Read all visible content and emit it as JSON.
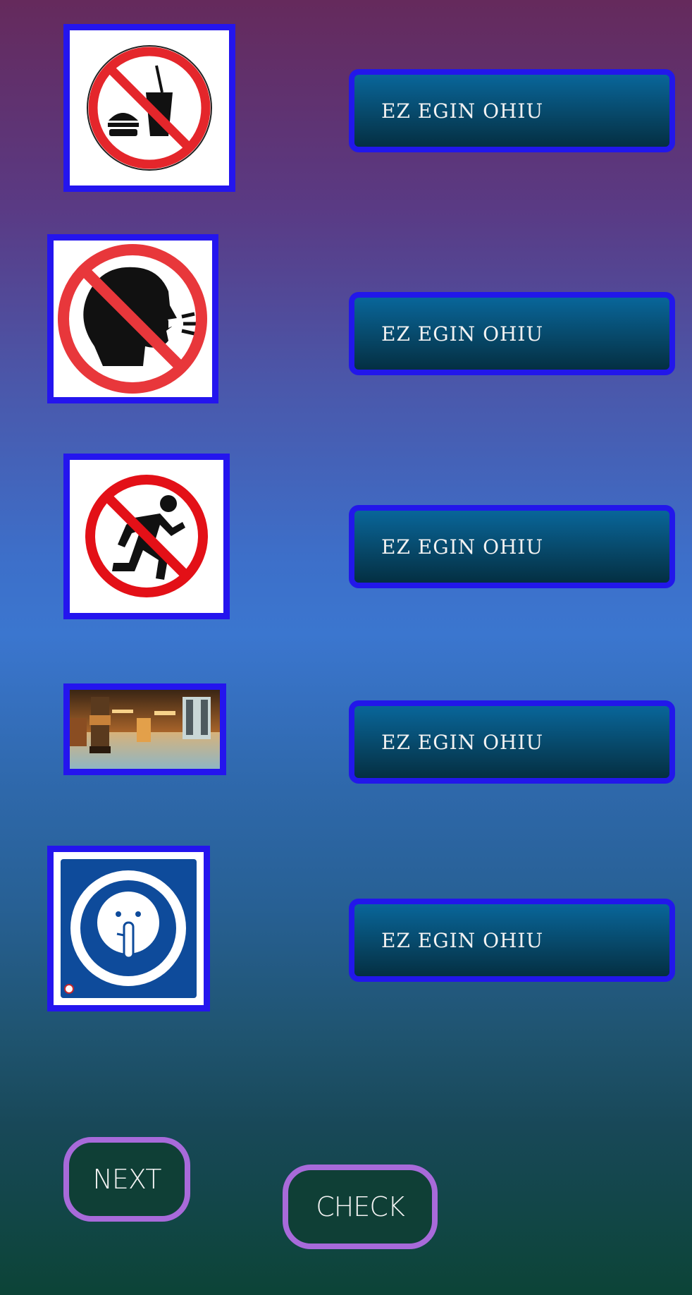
{
  "rows": [
    {
      "sign_icon": "no-food-drink-icon",
      "answer_label": "EZ EGIN OHIU"
    },
    {
      "sign_icon": "no-shouting-icon",
      "answer_label": "EZ EGIN OHIU"
    },
    {
      "sign_icon": "no-running-icon",
      "answer_label": "EZ EGIN OHIU"
    },
    {
      "sign_icon": "hallway-photo",
      "answer_label": "EZ EGIN OHIU"
    },
    {
      "sign_icon": "keep-quiet-icon",
      "answer_label": "EZ EGIN OHIU"
    }
  ],
  "buttons": {
    "next_label": "NEXT",
    "check_label": "CHECK"
  },
  "colors": {
    "frame_border": "#2415ee",
    "answer_border": "#2217ea",
    "answer_fill": "#074869",
    "nav_border": "#a86ada",
    "prohibition_red": "#e8222a"
  }
}
